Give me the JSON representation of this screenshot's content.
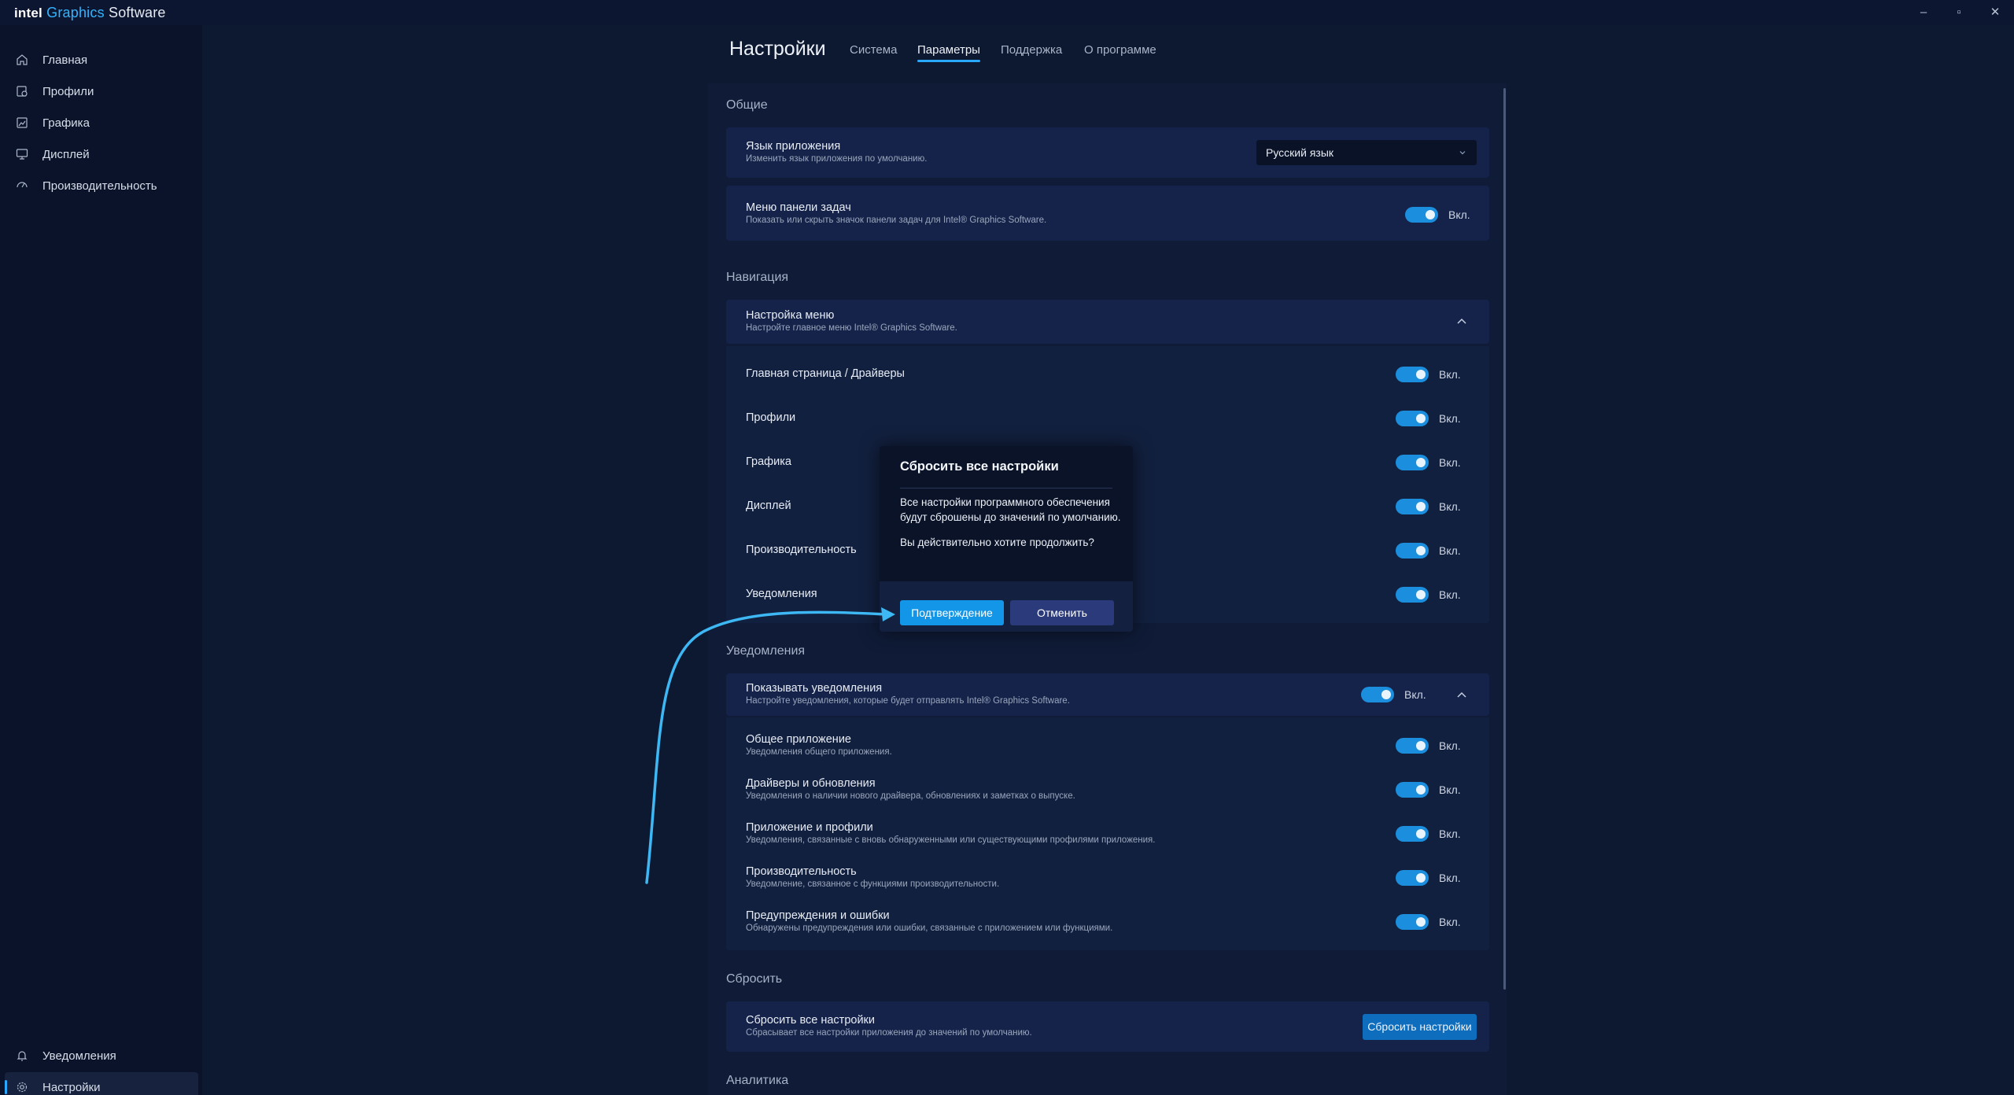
{
  "app": {
    "brand_intel": "intel",
    "brand_graphics": "Graphics",
    "brand_software": "Software",
    "window_controls": [
      "–",
      "▫",
      "✕"
    ]
  },
  "sidebar": {
    "items": [
      {
        "label": "Главная",
        "icon": "home-icon"
      },
      {
        "label": "Профили",
        "icon": "profiles-icon"
      },
      {
        "label": "Графика",
        "icon": "graphics-icon"
      },
      {
        "label": "Дисплей",
        "icon": "display-icon"
      },
      {
        "label": "Производительность",
        "icon": "performance-icon"
      }
    ],
    "bottom": [
      {
        "label": "Уведомления",
        "icon": "bell-icon"
      },
      {
        "label": "Настройки",
        "icon": "gear-icon"
      }
    ]
  },
  "header": {
    "title": "Настройки",
    "tabs": [
      "Система",
      "Параметры",
      "Поддержка",
      "О программе"
    ],
    "active_tab": "Параметры"
  },
  "general": {
    "heading": "Общие",
    "language": {
      "title": "Язык приложения",
      "desc": "Изменить язык приложения по умолчанию.",
      "value": "Русский язык"
    },
    "taskbar": {
      "title": "Меню панели задач",
      "desc": "Показать или скрыть значок панели задач для Intel® Graphics Software.",
      "state": "Вкл."
    }
  },
  "navigation": {
    "heading": "Навигация",
    "menu": {
      "title": "Настройка меню",
      "desc": "Настройте главное меню Intel® Graphics Software."
    },
    "items": [
      {
        "label": "Главная страница / Драйверы",
        "state": "Вкл."
      },
      {
        "label": "Профили",
        "state": "Вкл."
      },
      {
        "label": "Графика",
        "state": "Вкл."
      },
      {
        "label": "Дисплей",
        "state": "Вкл."
      },
      {
        "label": "Производительность",
        "state": "Вкл."
      },
      {
        "label": "Уведомления",
        "state": "Вкл."
      }
    ]
  },
  "notifications": {
    "heading": "Уведомления",
    "show": {
      "title": "Показывать уведомления",
      "desc": "Настройте уведомления, которые будет отправлять Intel® Graphics Software.",
      "state": "Вкл."
    },
    "items": [
      {
        "title": "Общее приложение",
        "desc": "Уведомления общего приложения.",
        "state": "Вкл."
      },
      {
        "title": "Драйверы и обновления",
        "desc": "Уведомления о наличии нового драйвера, обновлениях и заметках о выпуске.",
        "state": "Вкл."
      },
      {
        "title": "Приложение и профили",
        "desc": "Уведомления, связанные с вновь обнаруженными или существующими профилями приложения.",
        "state": "Вкл."
      },
      {
        "title": "Производительность",
        "desc": "Уведомление, связанное с функциями производительности.",
        "state": "Вкл."
      },
      {
        "title": "Предупреждения и ошибки",
        "desc": "Обнаружены предупреждения или ошибки, связанные с приложением или функциями.",
        "state": "Вкл."
      }
    ]
  },
  "reset": {
    "heading": "Сбросить",
    "title": "Сбросить все настройки",
    "desc": "Сбрасывает все настройки приложения до значений по умолчанию.",
    "button": "Сбросить настройки"
  },
  "analytics": {
    "heading": "Аналитика"
  },
  "dialog": {
    "title": "Сбросить все настройки",
    "body_line1": "Все настройки программного обеспечения",
    "body_line2": "будут сброшены до значений по умолчанию.",
    "question": "Вы действительно хотите продолжить?",
    "confirm": "Подтверждение",
    "cancel": "Отменить"
  },
  "colors": {
    "accent": "#29a8ff",
    "annotation_arrow": "#3db8f5"
  }
}
